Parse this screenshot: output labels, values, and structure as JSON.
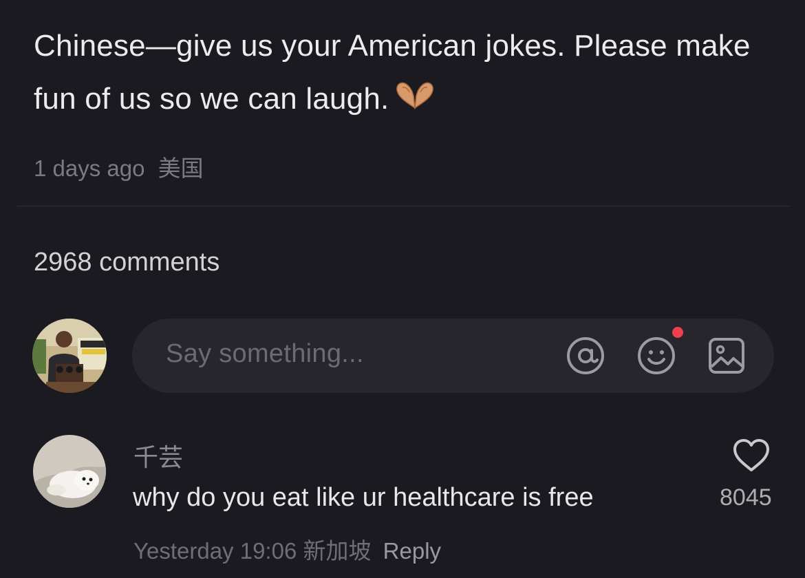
{
  "post": {
    "text": "Chinese—give us your American jokes. Please make fun of us so we can laugh.",
    "emoji": "heart-hands-emoji",
    "time_ago": "1 days ago",
    "location": "美国"
  },
  "comments_section": {
    "count_label": "2968 comments",
    "input_placeholder": "Say something...",
    "icons": [
      "at-sign-icon",
      "emoji-face-icon",
      "image-icon"
    ],
    "emoji_badge_color": "#f0404c"
  },
  "comments": [
    {
      "username": "千芸",
      "text": "why do you eat like ur healthcare is free",
      "timestamp": "Yesterday 19:06",
      "location": "新加坡",
      "reply_label": "Reply",
      "likes": "8045"
    }
  ],
  "colors": {
    "background": "#1b1a20",
    "input_background": "#27262c",
    "primary_text": "#ececee",
    "secondary_text": "#7b7a80"
  }
}
